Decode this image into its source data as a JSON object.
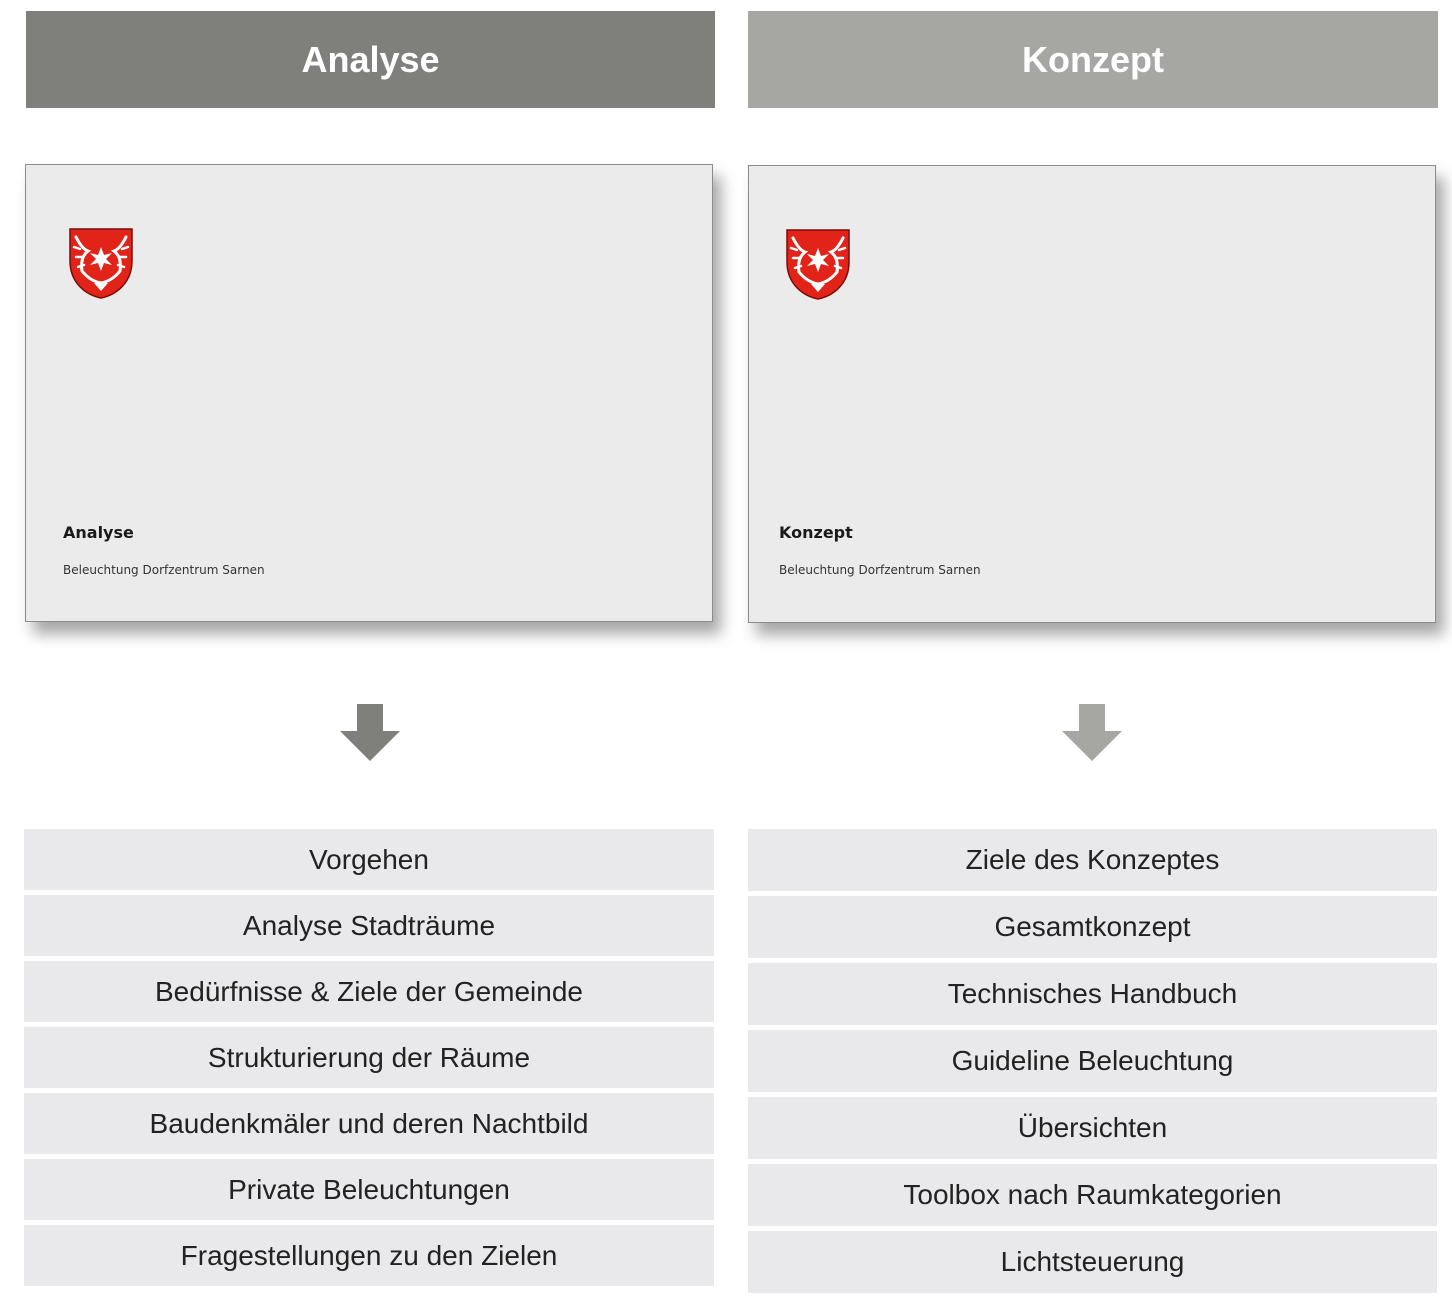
{
  "colors": {
    "header_left": "#7f7f7b",
    "header_right": "#a6a6a2",
    "arrow_left": "#7f7f7b",
    "arrow_right": "#a6a6a2",
    "cover_bg": "#ebebeb",
    "list_bg": "#e9e9eb",
    "crest_red": "#e2231a"
  },
  "columns": [
    {
      "header": "Analyse",
      "cover": {
        "logo": "sarnen-coat-of-arms",
        "title": "Analyse",
        "subtitle": "Beleuchtung Dorfzentrum Sarnen"
      },
      "arrow_icon": "arrow-down-icon",
      "items": [
        "Vorgehen",
        "Analyse Stadträume",
        "Bedürfnisse & Ziele der Gemeinde",
        "Strukturierung der Räume",
        "Baudenkmäler und deren Nachtbild",
        "Private Beleuchtungen",
        "Fragestellungen zu den Zielen"
      ]
    },
    {
      "header": "Konzept",
      "cover": {
        "logo": "sarnen-coat-of-arms",
        "title": "Konzept",
        "subtitle": "Beleuchtung Dorfzentrum Sarnen"
      },
      "arrow_icon": "arrow-down-icon",
      "items": [
        "Ziele des Konzeptes",
        "Gesamtkonzept",
        "Technisches Handbuch",
        "Guideline Beleuchtung",
        "Übersichten",
        "Toolbox nach Raumkategorien",
        "Lichtsteuerung"
      ]
    }
  ]
}
